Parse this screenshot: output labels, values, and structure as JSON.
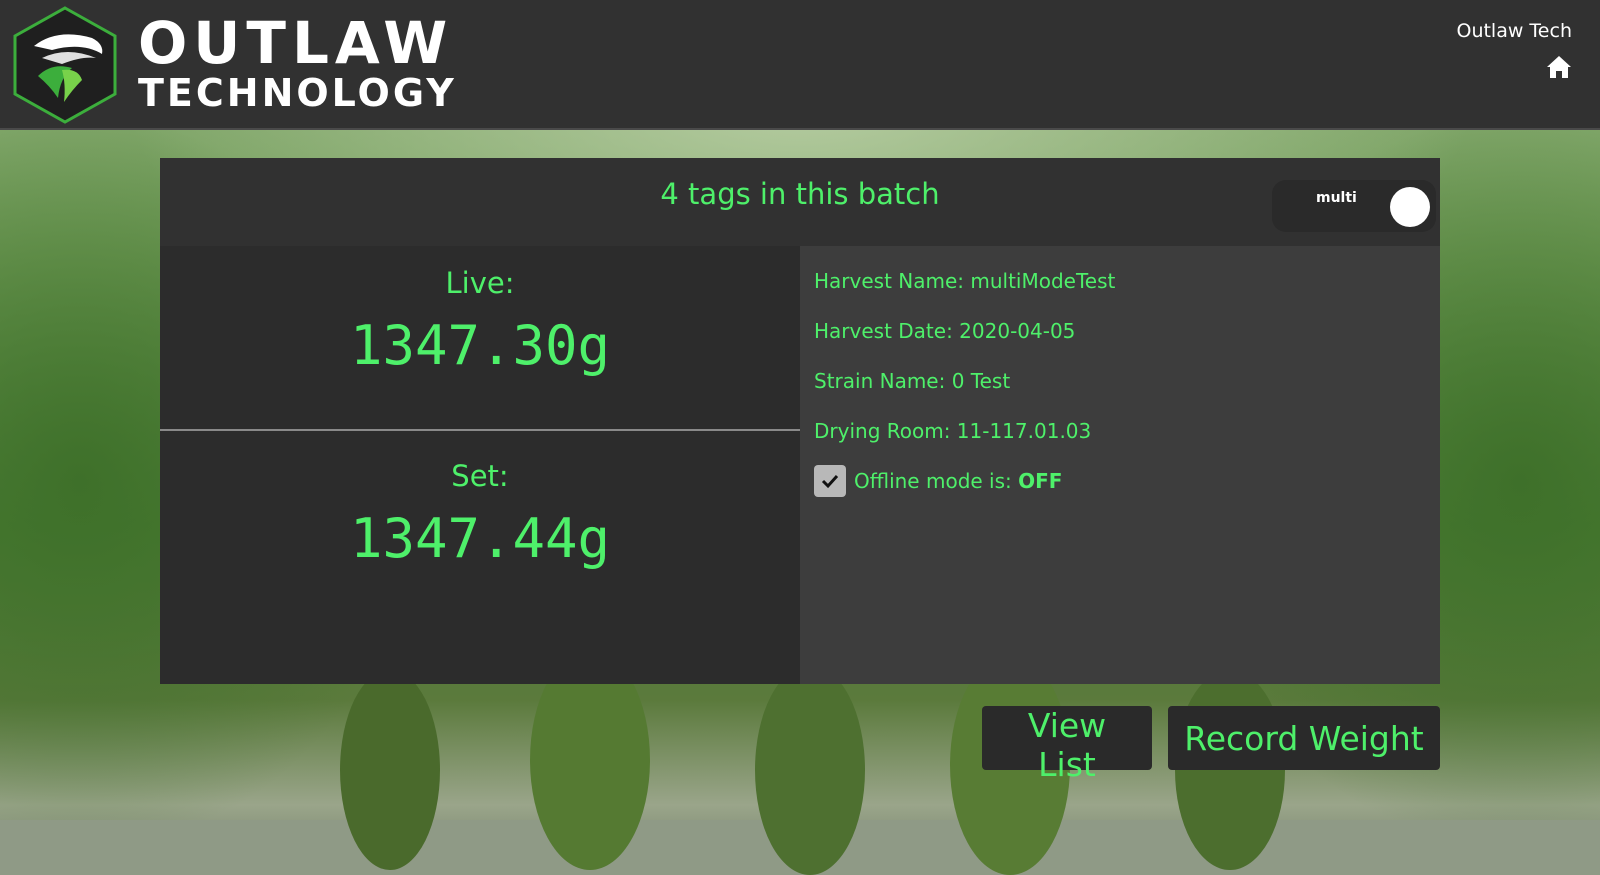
{
  "header": {
    "logo_line1": "OUTLAW",
    "logo_line2": "TECHNOLOGY",
    "user_name": "Outlaw Tech",
    "home_icon": "home-icon"
  },
  "batch": {
    "title": "4 tags in this batch",
    "mode_toggle_label": "multi"
  },
  "weights": {
    "live_label": "Live:",
    "live_value": "1347.30g",
    "set_label": "Set:",
    "set_value": "1347.44g"
  },
  "info": {
    "harvest_name": "Harvest Name: multiModeTest",
    "harvest_date": "Harvest Date: 2020-04-05",
    "strain_name": "Strain Name: 0 Test",
    "drying_room": "Drying Room: 11-117.01.03",
    "offline_label": "Offline mode is: ",
    "offline_state": "OFF",
    "offline_checked": true
  },
  "buttons": {
    "view_list": "View List",
    "record_weight": "Record Weight"
  },
  "colors": {
    "accent_green": "#4ef06a",
    "header_bg": "#313131",
    "panel_left": "#2c2c2c",
    "panel_right": "#3d3d3d"
  }
}
